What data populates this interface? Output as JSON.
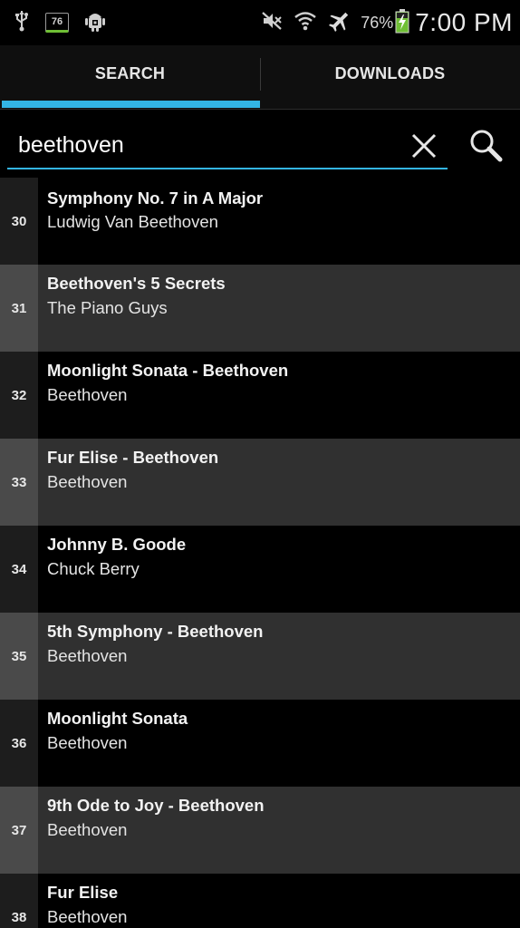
{
  "status_bar": {
    "notification_badge": "76",
    "battery_percent": "76%",
    "time": "7:00 PM",
    "icons": [
      "usb-icon",
      "notification-badge-icon",
      "android-debug-icon",
      "mute-icon",
      "wifi-icon",
      "airplane-mode-icon",
      "battery-charging-icon"
    ]
  },
  "tabs": [
    {
      "label": "SEARCH",
      "active": true
    },
    {
      "label": "DOWNLOADS",
      "active": false
    }
  ],
  "search": {
    "value": "beethoven",
    "placeholder": ""
  },
  "colors": {
    "accent": "#33b5e5",
    "row_dark": "#000000",
    "row_light": "#303030",
    "number_col_dark": "#1d1d1d",
    "number_col_light": "#4a4a4a",
    "battery_green": "#6fbf35"
  },
  "results": [
    {
      "number": "30",
      "title": "Symphony No. 7 in A Major",
      "artist": "Ludwig Van Beethoven"
    },
    {
      "number": "31",
      "title": "Beethoven's 5 Secrets",
      "artist": "The Piano Guys"
    },
    {
      "number": "32",
      "title": "Moonlight Sonata - Beethoven",
      "artist": "Beethoven"
    },
    {
      "number": "33",
      "title": "Fur Elise - Beethoven",
      "artist": "Beethoven"
    },
    {
      "number": "34",
      "title": "Johnny B. Goode",
      "artist": "Chuck Berry"
    },
    {
      "number": "35",
      "title": "5th Symphony - Beethoven",
      "artist": "Beethoven"
    },
    {
      "number": "36",
      "title": "Moonlight Sonata",
      "artist": "Beethoven"
    },
    {
      "number": "37",
      "title": "9th Ode to Joy - Beethoven",
      "artist": "Beethoven"
    },
    {
      "number": "38",
      "title": "Fur Elise",
      "artist": "Beethoven"
    }
  ]
}
